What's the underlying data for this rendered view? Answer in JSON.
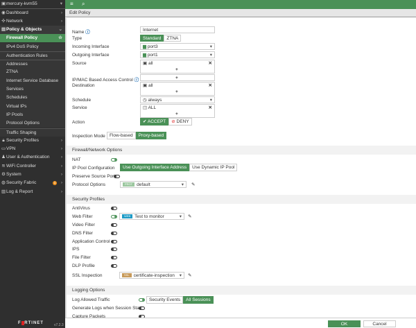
{
  "sidebar": {
    "device": "mercury-kvm55",
    "items": [
      {
        "label": "Dashboard",
        "icon": "dashboard-icon"
      },
      {
        "label": "Network",
        "icon": "network-icon"
      },
      {
        "label": "Policy & Objects",
        "icon": "policy-icon"
      },
      {
        "label": "Firewall Policy"
      },
      {
        "label": "IPv4 DoS Policy"
      },
      {
        "label": "Authentication Rules"
      },
      {
        "label": "Addresses"
      },
      {
        "label": "ZTNA"
      },
      {
        "label": "Internet Service Database"
      },
      {
        "label": "Services"
      },
      {
        "label": "Schedules"
      },
      {
        "label": "Virtual IPs"
      },
      {
        "label": "IP Pools"
      },
      {
        "label": "Protocol Options"
      },
      {
        "label": "Traffic Shaping"
      },
      {
        "label": "Security Profiles"
      },
      {
        "label": "VPN"
      },
      {
        "label": "User & Authentication"
      },
      {
        "label": "WiFi Controller"
      },
      {
        "label": "System"
      },
      {
        "label": "Security Fabric",
        "badge": "1"
      },
      {
        "label": "Log & Report"
      }
    ],
    "brand": "F◼RTINET",
    "version": "v7.2.3"
  },
  "header": {
    "title": "Edit Policy"
  },
  "form": {
    "name_label": "Name",
    "name_value": "Internet",
    "type_label": "Type",
    "type_options": [
      "Standard",
      "ZTNA"
    ],
    "incoming_label": "Incoming Interface",
    "incoming_value": "port3",
    "outgoing_label": "Outgoing Interface",
    "outgoing_value": "port1",
    "source_label": "Source",
    "source_value": "all",
    "ipmac_label": "IP/MAC Based Access Control",
    "destination_label": "Destination",
    "destination_value": "all",
    "schedule_label": "Schedule",
    "schedule_value": "always",
    "service_label": "Service",
    "service_value": "ALL",
    "action_label": "Action",
    "action_accept": "ACCEPT",
    "action_deny": "DENY",
    "inspection_label": "Inspection Mode",
    "inspection_options": [
      "Flow-based",
      "Proxy-based"
    ]
  },
  "fw": {
    "title": "Firewall/Network Options",
    "nat": "NAT",
    "ippool_label": "IP Pool Configuration",
    "ippool_options": [
      "Use Outgoing Interface Address",
      "Use Dynamic IP Pool"
    ],
    "preserve": "Preserve Source Port",
    "proto_label": "Protocol Options",
    "proto_tag": "PROT",
    "proto_value": "default"
  },
  "sec": {
    "title": "Security Profiles",
    "antivirus": "AntiVirus",
    "webfilter": "Web Filter",
    "web_tag": "WEB",
    "web_value": "Test to monitor",
    "video": "Video Filter",
    "dns": "DNS Filter",
    "app": "Application Control",
    "ips": "IPS",
    "file": "File Filter",
    "dlp": "DLP Profile",
    "ssl_label": "SSL Inspection",
    "ssl_tag": "SSL",
    "ssl_value": "certificate-inspection"
  },
  "log": {
    "title": "Logging Options",
    "allowed": "Log Allowed Traffic",
    "allowed_options": [
      "Security Events",
      "All Sessions"
    ],
    "generate": "Generate Logs when Session Starts",
    "capture": "Capture Packets"
  },
  "footer": {
    "ok": "OK",
    "cancel": "Cancel"
  },
  "colors": {
    "accent": "#4a9157",
    "sidebar": "#2f2f2f"
  }
}
